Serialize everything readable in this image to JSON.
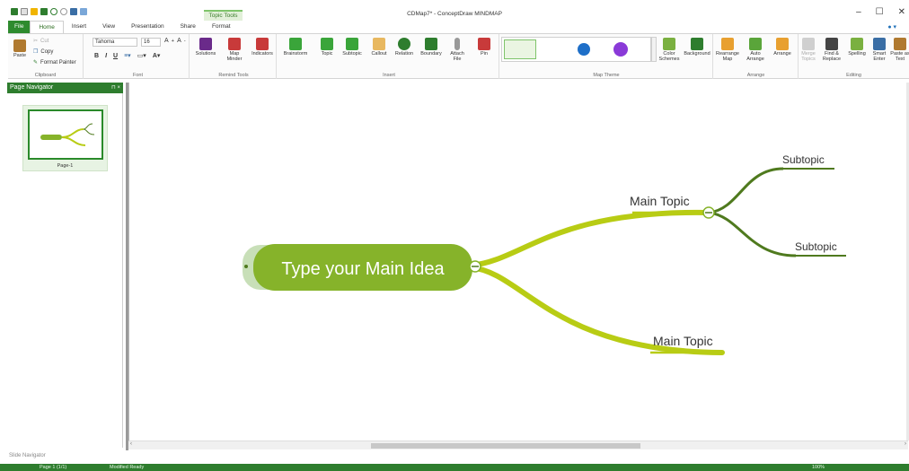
{
  "window": {
    "title": "CDMap7* - ConceptDraw MINDMAP",
    "contextual_tab": "Topic Tools",
    "controls": {
      "minimize": "–",
      "maximize": "☐",
      "close": "✕"
    }
  },
  "tabs": [
    "File",
    "Home",
    "Insert",
    "View",
    "Presentation",
    "Share",
    "Format"
  ],
  "active_tab": "Home",
  "ribbon": {
    "clipboard": {
      "label": "Clipboard",
      "paste": "Paste",
      "cut": "Cut",
      "copy": "Copy",
      "format_painter": "Format Painter"
    },
    "font": {
      "label": "Font",
      "family": "Tahoma",
      "size": "16",
      "bold": "B",
      "italic": "I",
      "underline": "U"
    },
    "remind_tools": {
      "label": "Remind Tools",
      "solutions": "Solutions",
      "map_minder": "Map Minder",
      "indicators": "Indicators"
    },
    "insert": {
      "label": "Insert",
      "brainstorm": "Brainstorm",
      "topic": "Topic",
      "subtopic": "Subtopic",
      "callout": "Callout",
      "relation": "Relation",
      "boundary": "Boundary",
      "attach_file": "Attach File",
      "pin": "Pin"
    },
    "map_theme": {
      "label": "Map Theme",
      "color_schemes": "Color Schemes",
      "background": "Background"
    },
    "arrange": {
      "label": "Arrange",
      "rearrange_map": "Rearrange Map",
      "auto_arrange": "Auto Arrange",
      "arrange": "Arrange"
    },
    "editing": {
      "label": "Editing",
      "merge_topics": "Merge Topics",
      "find_replace": "Find & Replace",
      "spelling": "Spelling",
      "smart_enter": "Smart Enter",
      "paste_as_text": "Paste as Text"
    }
  },
  "page_navigator": {
    "title": "Page Navigator",
    "pin": "⊓ ×",
    "pages": [
      {
        "label": "Page-1"
      }
    ]
  },
  "map": {
    "main_idea": "Type your Main Idea",
    "main_topic_1": "Main Topic",
    "main_topic_2": "Main Topic",
    "subtopic_1": "Subtopic",
    "subtopic_2": "Subtopic",
    "colors": {
      "main_idea_fill": "#86b32a",
      "branch": "#b8cc14",
      "sub_branch": "#4f7a1e"
    }
  },
  "slide_navigator": "Slide Navigator",
  "status": {
    "page": "Page 1 (1/1)",
    "state": "Modified  Ready",
    "zoom": "100%"
  }
}
